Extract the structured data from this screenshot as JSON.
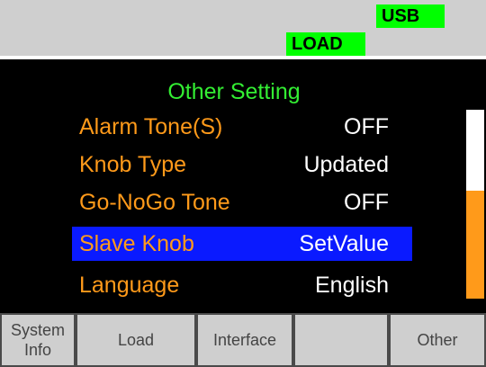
{
  "status": {
    "usb_badge": "USB",
    "load_badge": "LOAD"
  },
  "menu": {
    "title": "Other Setting",
    "items": [
      {
        "label": "Alarm Tone(S)",
        "value": "OFF"
      },
      {
        "label": "Knob Type",
        "value": "Updated"
      },
      {
        "label": "Go-NoGo Tone",
        "value": "OFF"
      },
      {
        "label": "Slave Knob",
        "value": "SetValue",
        "selected": true
      },
      {
        "label": "Language",
        "value": "English"
      }
    ],
    "scroll_position_fraction": 0.55
  },
  "softkeys": [
    {
      "label": "System\nInfo"
    },
    {
      "label": "Load"
    },
    {
      "label": "Interface"
    },
    {
      "label": ""
    },
    {
      "label": "Other"
    }
  ],
  "colors": {
    "label": "#ff9a1a",
    "value": "#ffffff",
    "title": "#33ee33",
    "selection": "#0a1aff",
    "badge": "#00ff00"
  }
}
